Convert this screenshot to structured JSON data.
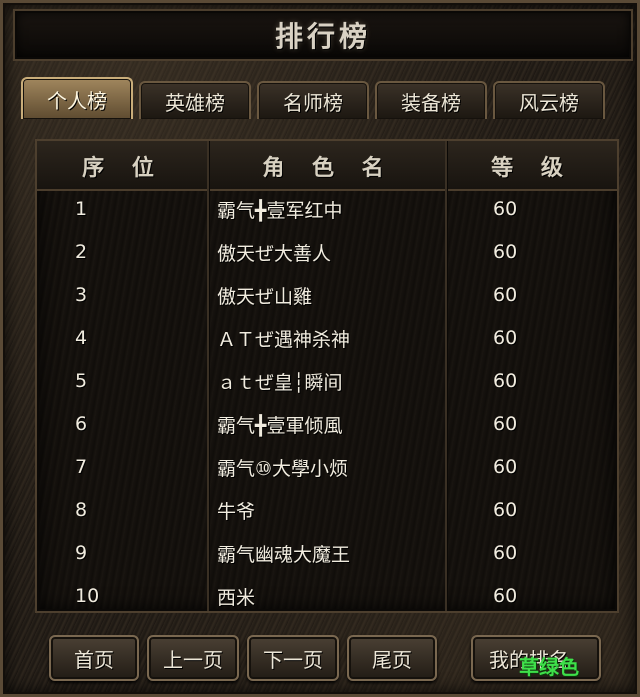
{
  "title": "排行榜",
  "tabs": [
    {
      "label": "个人榜",
      "active": true
    },
    {
      "label": "英雄榜",
      "active": false
    },
    {
      "label": "名师榜",
      "active": false
    },
    {
      "label": "装备榜",
      "active": false
    },
    {
      "label": "风云榜",
      "active": false
    }
  ],
  "table": {
    "headers": [
      "序 位",
      "角 色 名",
      "等 级"
    ],
    "rows": [
      {
        "rank": "1",
        "name": "霸气╋壹军红中",
        "level": "60"
      },
      {
        "rank": "2",
        "name": "傲天ぜ大善人",
        "level": "60"
      },
      {
        "rank": "3",
        "name": "傲天ぜ山雞",
        "level": "60"
      },
      {
        "rank": "4",
        "name": "ＡＴぜ遇神杀神",
        "level": "60"
      },
      {
        "rank": "5",
        "name": "ａｔぜ皇┆瞬间",
        "level": "60"
      },
      {
        "rank": "6",
        "name": "霸气╋壹軍倾風",
        "level": "60"
      },
      {
        "rank": "7",
        "name": "霸气⑩大學小烦",
        "level": "60"
      },
      {
        "rank": "8",
        "name": "牛爷",
        "level": "60"
      },
      {
        "rank": "9",
        "name": "霸气幽魂大魔王",
        "level": "60"
      },
      {
        "rank": "10",
        "name": "西米",
        "level": "60"
      }
    ]
  },
  "buttons": {
    "first": "首页",
    "prev": "上一页",
    "next": "下一页",
    "last": "尾页",
    "my_rank": "我的排名"
  },
  "watermark": "草绿色",
  "colors": {
    "active_tab": "#a0865d",
    "watermark": "#3ee04a"
  }
}
